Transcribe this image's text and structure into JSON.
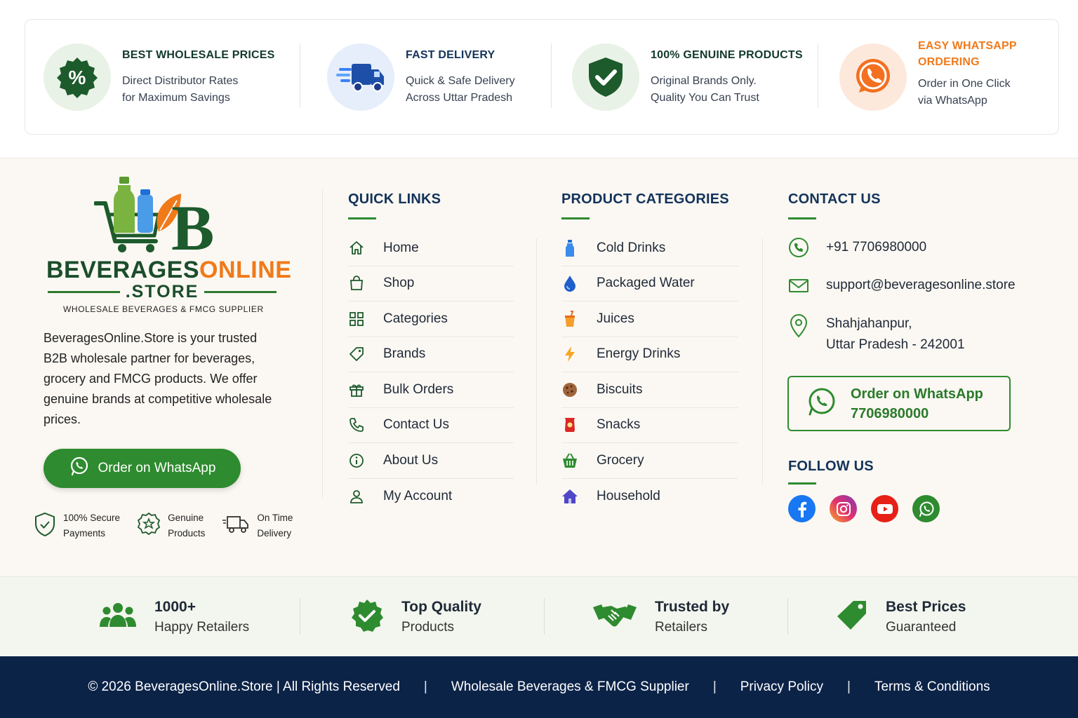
{
  "features": [
    {
      "icon": "percent-badge-icon",
      "title": "BEST WHOLESALE PRICES",
      "lines": [
        "Direct Distributor Rates",
        "for Maximum Savings"
      ]
    },
    {
      "icon": "delivery-truck-icon",
      "title": "FAST DELIVERY",
      "lines": [
        "Quick & Safe Delivery",
        "Across Uttar Pradesh"
      ]
    },
    {
      "icon": "shield-check-icon",
      "title": "100% GENUINE PRODUCTS",
      "lines": [
        "Original Brands Only.",
        "Quality You Can Trust"
      ]
    },
    {
      "icon": "whatsapp-icon",
      "title_lines": [
        "EASY WHATSAPP",
        "ORDERING"
      ],
      "lines": [
        "Order in One Click",
        "via WhatsApp"
      ]
    }
  ],
  "brand": {
    "logo_word_dark": "BEVERAGES",
    "logo_word_orange": "ONLINE",
    "logo_store": ".STORE",
    "logo_tagline": "WHOLESALE BEVERAGES & FMCG SUPPLIER",
    "description": "BeveragesOnline.Store is your trusted B2B wholesale partner for beverages, grocery and FMCG products. We offer genuine brands at competitive wholesale prices.",
    "whatsapp_button": "Order on WhatsApp",
    "badges": [
      {
        "icon": "shield-check-icon",
        "lines": [
          "100% Secure",
          "Payments"
        ]
      },
      {
        "icon": "star-badge-icon",
        "lines": [
          "Genuine",
          "Products"
        ]
      },
      {
        "icon": "delivery-truck-icon",
        "lines": [
          "On Time",
          "Delivery"
        ]
      }
    ]
  },
  "quick_links": {
    "title": "QUICK LINKS",
    "items": [
      {
        "icon": "home-icon",
        "label": "Home"
      },
      {
        "icon": "shopping-bag-icon",
        "label": "Shop"
      },
      {
        "icon": "grid-icon",
        "label": "Categories"
      },
      {
        "icon": "tag-icon",
        "label": "Brands"
      },
      {
        "icon": "gift-icon",
        "label": "Bulk Orders"
      },
      {
        "icon": "phone-icon",
        "label": "Contact Us"
      },
      {
        "icon": "info-icon",
        "label": "About Us"
      },
      {
        "icon": "user-icon",
        "label": "My Account"
      }
    ]
  },
  "product_categories": {
    "title": "PRODUCT CATEGORIES",
    "items": [
      {
        "icon": "bottle-icon",
        "label": "Cold Drinks"
      },
      {
        "icon": "water-drop-icon",
        "label": "Packaged Water"
      },
      {
        "icon": "juice-cup-icon",
        "label": "Juices"
      },
      {
        "icon": "lightning-icon",
        "label": "Energy Drinks"
      },
      {
        "icon": "cookie-icon",
        "label": "Biscuits"
      },
      {
        "icon": "snack-pack-icon",
        "label": "Snacks"
      },
      {
        "icon": "basket-icon",
        "label": "Grocery"
      },
      {
        "icon": "house-icon",
        "label": "Household"
      }
    ]
  },
  "contact": {
    "title": "CONTACT US",
    "phone": "+91 7706980000",
    "email": "support@beveragesonline.store",
    "address_lines": [
      "Shahjahanpur,",
      "Uttar Pradesh - 242001"
    ],
    "whatsapp_box_lines": [
      "Order on WhatsApp",
      "7706980000"
    ],
    "follow_title": "FOLLOW US",
    "socials": [
      {
        "icon": "facebook-icon",
        "color": "#1877f2"
      },
      {
        "icon": "instagram-icon",
        "color": "#e1306c"
      },
      {
        "icon": "youtube-icon",
        "color": "#e62117"
      },
      {
        "icon": "whatsapp-icon",
        "color": "#2e8b2f"
      }
    ]
  },
  "stats": [
    {
      "icon": "users-icon",
      "title": "1000+",
      "subtitle": "Happy Retailers"
    },
    {
      "icon": "quality-badge-icon",
      "title": "Top Quality",
      "subtitle": "Products"
    },
    {
      "icon": "handshake-icon",
      "title": "Trusted by",
      "subtitle": "Retailers"
    },
    {
      "icon": "price-tag-icon",
      "title": "Best Prices",
      "subtitle": "Guaranteed"
    }
  ],
  "bottom_bar": {
    "copyright": "© 2026 BeveragesOnline.Store | All Rights Reserved",
    "separator": "|",
    "links": [
      "Wholesale Beverages & FMCG Supplier",
      "Privacy Policy",
      "Terms & Conditions"
    ]
  },
  "colors": {
    "brand_green": "#2e8b2f",
    "navy": "#0c2348",
    "heading_blue": "#13335a",
    "orange": "#f07a1a"
  }
}
